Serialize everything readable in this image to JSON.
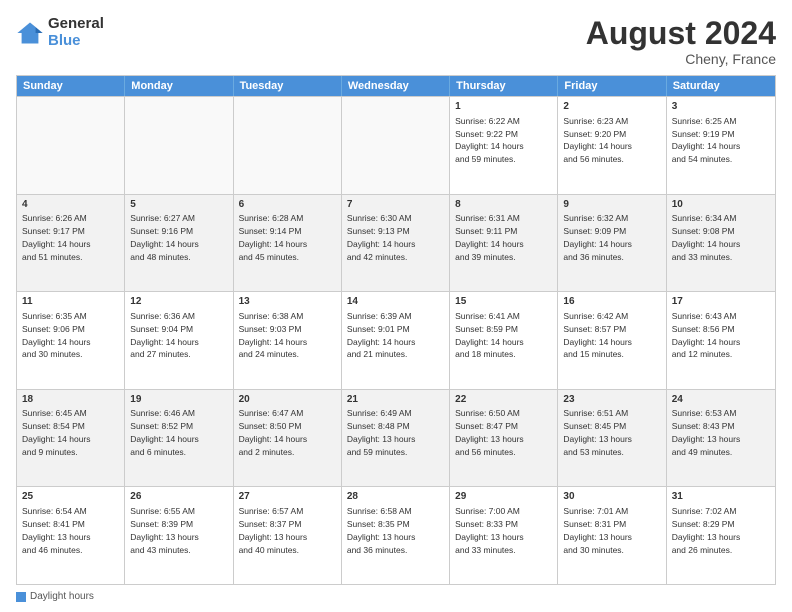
{
  "logo": {
    "general": "General",
    "blue": "Blue"
  },
  "title": {
    "month_year": "August 2024",
    "location": "Cheny, France"
  },
  "days_of_week": [
    "Sunday",
    "Monday",
    "Tuesday",
    "Wednesday",
    "Thursday",
    "Friday",
    "Saturday"
  ],
  "footer": {
    "label": "Daylight hours"
  },
  "weeks": [
    [
      {
        "day": "",
        "text": "",
        "empty": true
      },
      {
        "day": "",
        "text": "",
        "empty": true
      },
      {
        "day": "",
        "text": "",
        "empty": true
      },
      {
        "day": "",
        "text": "",
        "empty": true
      },
      {
        "day": "1",
        "text": "Sunrise: 6:22 AM\nSunset: 9:22 PM\nDaylight: 14 hours\nand 59 minutes.",
        "empty": false
      },
      {
        "day": "2",
        "text": "Sunrise: 6:23 AM\nSunset: 9:20 PM\nDaylight: 14 hours\nand 56 minutes.",
        "empty": false
      },
      {
        "day": "3",
        "text": "Sunrise: 6:25 AM\nSunset: 9:19 PM\nDaylight: 14 hours\nand 54 minutes.",
        "empty": false
      }
    ],
    [
      {
        "day": "4",
        "text": "Sunrise: 6:26 AM\nSunset: 9:17 PM\nDaylight: 14 hours\nand 51 minutes.",
        "empty": false,
        "shaded": true
      },
      {
        "day": "5",
        "text": "Sunrise: 6:27 AM\nSunset: 9:16 PM\nDaylight: 14 hours\nand 48 minutes.",
        "empty": false,
        "shaded": true
      },
      {
        "day": "6",
        "text": "Sunrise: 6:28 AM\nSunset: 9:14 PM\nDaylight: 14 hours\nand 45 minutes.",
        "empty": false,
        "shaded": true
      },
      {
        "day": "7",
        "text": "Sunrise: 6:30 AM\nSunset: 9:13 PM\nDaylight: 14 hours\nand 42 minutes.",
        "empty": false,
        "shaded": true
      },
      {
        "day": "8",
        "text": "Sunrise: 6:31 AM\nSunset: 9:11 PM\nDaylight: 14 hours\nand 39 minutes.",
        "empty": false,
        "shaded": true
      },
      {
        "day": "9",
        "text": "Sunrise: 6:32 AM\nSunset: 9:09 PM\nDaylight: 14 hours\nand 36 minutes.",
        "empty": false,
        "shaded": true
      },
      {
        "day": "10",
        "text": "Sunrise: 6:34 AM\nSunset: 9:08 PM\nDaylight: 14 hours\nand 33 minutes.",
        "empty": false,
        "shaded": true
      }
    ],
    [
      {
        "day": "11",
        "text": "Sunrise: 6:35 AM\nSunset: 9:06 PM\nDaylight: 14 hours\nand 30 minutes.",
        "empty": false
      },
      {
        "day": "12",
        "text": "Sunrise: 6:36 AM\nSunset: 9:04 PM\nDaylight: 14 hours\nand 27 minutes.",
        "empty": false
      },
      {
        "day": "13",
        "text": "Sunrise: 6:38 AM\nSunset: 9:03 PM\nDaylight: 14 hours\nand 24 minutes.",
        "empty": false
      },
      {
        "day": "14",
        "text": "Sunrise: 6:39 AM\nSunset: 9:01 PM\nDaylight: 14 hours\nand 21 minutes.",
        "empty": false
      },
      {
        "day": "15",
        "text": "Sunrise: 6:41 AM\nSunset: 8:59 PM\nDaylight: 14 hours\nand 18 minutes.",
        "empty": false
      },
      {
        "day": "16",
        "text": "Sunrise: 6:42 AM\nSunset: 8:57 PM\nDaylight: 14 hours\nand 15 minutes.",
        "empty": false
      },
      {
        "day": "17",
        "text": "Sunrise: 6:43 AM\nSunset: 8:56 PM\nDaylight: 14 hours\nand 12 minutes.",
        "empty": false
      }
    ],
    [
      {
        "day": "18",
        "text": "Sunrise: 6:45 AM\nSunset: 8:54 PM\nDaylight: 14 hours\nand 9 minutes.",
        "empty": false,
        "shaded": true
      },
      {
        "day": "19",
        "text": "Sunrise: 6:46 AM\nSunset: 8:52 PM\nDaylight: 14 hours\nand 6 minutes.",
        "empty": false,
        "shaded": true
      },
      {
        "day": "20",
        "text": "Sunrise: 6:47 AM\nSunset: 8:50 PM\nDaylight: 14 hours\nand 2 minutes.",
        "empty": false,
        "shaded": true
      },
      {
        "day": "21",
        "text": "Sunrise: 6:49 AM\nSunset: 8:48 PM\nDaylight: 13 hours\nand 59 minutes.",
        "empty": false,
        "shaded": true
      },
      {
        "day": "22",
        "text": "Sunrise: 6:50 AM\nSunset: 8:47 PM\nDaylight: 13 hours\nand 56 minutes.",
        "empty": false,
        "shaded": true
      },
      {
        "day": "23",
        "text": "Sunrise: 6:51 AM\nSunset: 8:45 PM\nDaylight: 13 hours\nand 53 minutes.",
        "empty": false,
        "shaded": true
      },
      {
        "day": "24",
        "text": "Sunrise: 6:53 AM\nSunset: 8:43 PM\nDaylight: 13 hours\nand 49 minutes.",
        "empty": false,
        "shaded": true
      }
    ],
    [
      {
        "day": "25",
        "text": "Sunrise: 6:54 AM\nSunset: 8:41 PM\nDaylight: 13 hours\nand 46 minutes.",
        "empty": false
      },
      {
        "day": "26",
        "text": "Sunrise: 6:55 AM\nSunset: 8:39 PM\nDaylight: 13 hours\nand 43 minutes.",
        "empty": false
      },
      {
        "day": "27",
        "text": "Sunrise: 6:57 AM\nSunset: 8:37 PM\nDaylight: 13 hours\nand 40 minutes.",
        "empty": false
      },
      {
        "day": "28",
        "text": "Sunrise: 6:58 AM\nSunset: 8:35 PM\nDaylight: 13 hours\nand 36 minutes.",
        "empty": false
      },
      {
        "day": "29",
        "text": "Sunrise: 7:00 AM\nSunset: 8:33 PM\nDaylight: 13 hours\nand 33 minutes.",
        "empty": false
      },
      {
        "day": "30",
        "text": "Sunrise: 7:01 AM\nSunset: 8:31 PM\nDaylight: 13 hours\nand 30 minutes.",
        "empty": false
      },
      {
        "day": "31",
        "text": "Sunrise: 7:02 AM\nSunset: 8:29 PM\nDaylight: 13 hours\nand 26 minutes.",
        "empty": false
      }
    ]
  ]
}
